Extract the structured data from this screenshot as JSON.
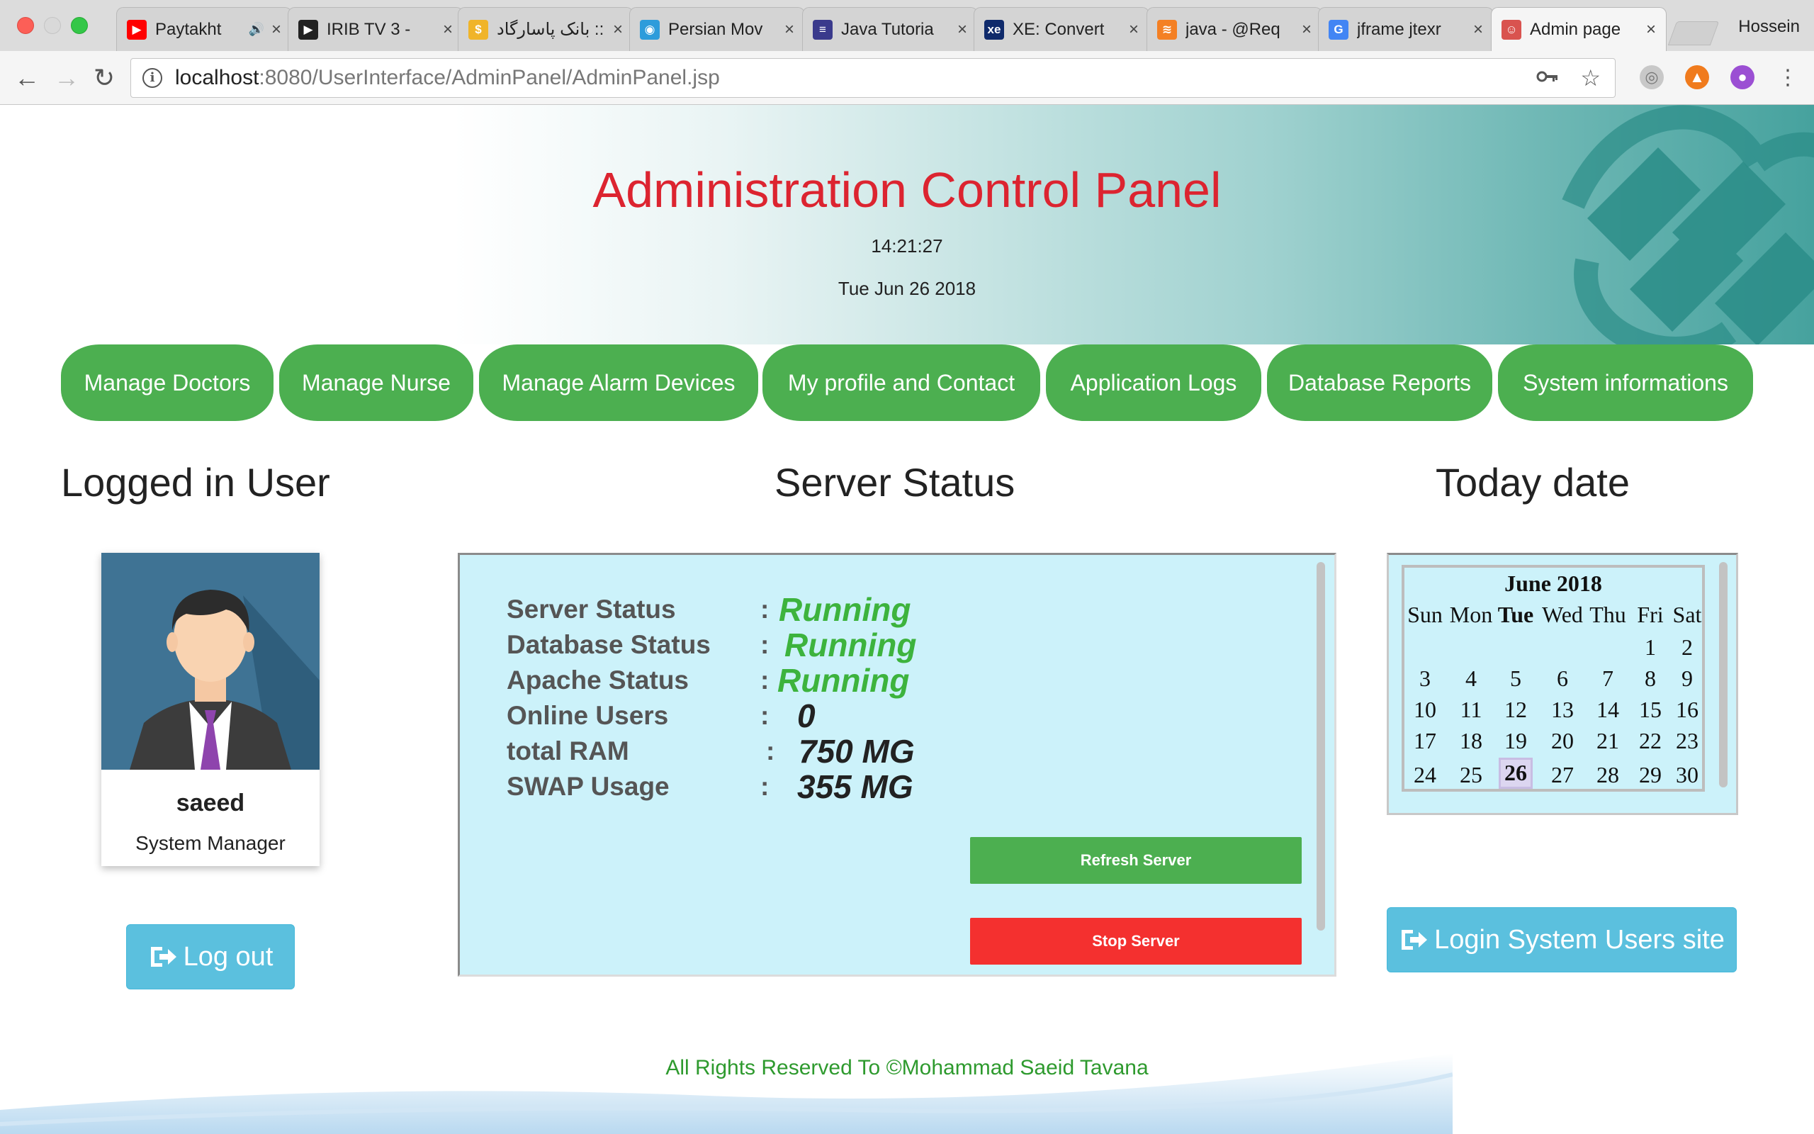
{
  "browser": {
    "tabs": [
      {
        "title": "Paytakht",
        "icon": "youtube-icon",
        "icon_color": "#ff0000",
        "has_audio": true
      },
      {
        "title": "IRIB TV 3 - ",
        "icon": "play-icon",
        "icon_color": "#222222"
      },
      {
        "title": "بانک پاسارگاد ::",
        "icon": "bank-icon",
        "icon_color": "#f0b429"
      },
      {
        "title": "Persian Mov",
        "icon": "film-icon",
        "icon_color": "#2d9cdb"
      },
      {
        "title": "Java Tutoria",
        "icon": "book-icon",
        "icon_color": "#3a3a8c"
      },
      {
        "title": "XE: Convert",
        "icon": "xe-icon",
        "icon_color": "#0f2a6b"
      },
      {
        "title": "java - @Req",
        "icon": "stackoverflow-icon",
        "icon_color": "#f48024"
      },
      {
        "title": "jframe jtexr",
        "icon": "google-icon",
        "icon_color": "#4285f4"
      },
      {
        "title": "Admin page",
        "icon": "admin-icon",
        "icon_color": "#d9534f",
        "active": true
      }
    ],
    "profile_name": "Hossein",
    "url_host": "localhost",
    "url_path": ":8080/UserInterface/AdminPanel/AdminPanel.jsp",
    "close_glyph": "×",
    "audio_glyph": "🔊"
  },
  "header": {
    "title": "Administration Control Panel",
    "time": "14:21:27",
    "date": "Tue Jun 26 2018"
  },
  "nav": {
    "items": [
      {
        "label": "Manage Doctors"
      },
      {
        "label": "Manage Nurse"
      },
      {
        "label": "Manage Alarm Devices"
      },
      {
        "label": "My profile and Contact"
      },
      {
        "label": "Application Logs"
      },
      {
        "label": "Database Reports"
      },
      {
        "label": "System informations"
      }
    ]
  },
  "user_section": {
    "heading": "Logged in User",
    "name": "saeed",
    "role": "System Manager",
    "logout_label": "Log out"
  },
  "server_section": {
    "heading": "Server Status",
    "rows": [
      {
        "label": "Server Status",
        "value": "Running",
        "color": "#3db33d"
      },
      {
        "label": "Database Status",
        "value": "Running",
        "color": "#3db33d"
      },
      {
        "label": "Apache Status",
        "value": "Running",
        "color": "#3db33d"
      },
      {
        "label": "Online Users",
        "value": "0",
        "color": "#222222"
      },
      {
        "label": "total RAM",
        "value": "750 MG",
        "color": "#222222"
      },
      {
        "label": "SWAP Usage",
        "value": "355 MG",
        "color": "#222222"
      }
    ],
    "colon": ":",
    "refresh_label": "Refresh Server",
    "stop_label": "Stop Server"
  },
  "date_section": {
    "heading": "Today date",
    "month_label": "June 2018",
    "weekdays": [
      "Sun",
      "Mon",
      "Tue",
      "Wed",
      "Thu",
      "Fri",
      "Sat"
    ],
    "highlight_weekday": "Tue",
    "weeks": [
      [
        "",
        "",
        "",
        "",
        "",
        "1",
        "2"
      ],
      [
        "3",
        "4",
        "5",
        "6",
        "7",
        "8",
        "9"
      ],
      [
        "10",
        "11",
        "12",
        "13",
        "14",
        "15",
        "16"
      ],
      [
        "17",
        "18",
        "19",
        "20",
        "21",
        "22",
        "23"
      ],
      [
        "24",
        "25",
        "26",
        "27",
        "28",
        "29",
        "30"
      ]
    ],
    "today": "26",
    "login_users_label": "Login System Users site"
  },
  "footer": {
    "text": "All Rights Reserved To ©Mohammad Saeid Tavana"
  },
  "colors": {
    "accent_green": "#4caf50",
    "title_red": "#dc2430",
    "info_blue": "#5bc0de",
    "danger_red": "#f4302f",
    "panel_bg": "#ccf2fa"
  }
}
